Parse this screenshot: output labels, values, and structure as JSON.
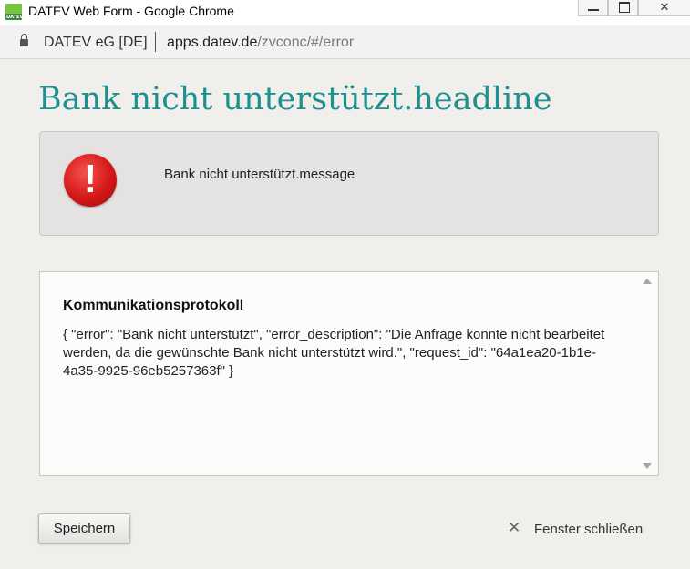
{
  "window": {
    "title": "DATEV Web Form - Google Chrome",
    "app_icon_text": "DATEV",
    "minimize_icon": "minimize-icon",
    "maximize_icon": "maximize-icon",
    "close_glyph": "✕"
  },
  "addressbar": {
    "site": "DATEV eG [DE]",
    "domain": "apps.datev.de",
    "path": "/zvconc/#/error",
    "lock_icon": "lock-icon"
  },
  "page": {
    "headline": "Bank nicht unterstützt.headline",
    "message": "Bank nicht unterstützt.message",
    "error_icon_glyph": "!",
    "log": {
      "title": "Kommunikationsprotokoll",
      "text": "{ \"error\": \"Bank nicht unterstützt\", \"error_description\": \"Die Anfrage konnte nicht bearbeitet werden, da die gewünschte Bank nicht unterstützt wird.\", \"request_id\": \"64a1ea20-1b1e-4a35-9925-96eb5257363f\" }"
    },
    "save_button": "Speichern",
    "close_link": "Fenster schließen",
    "close_link_glyph": "✕"
  },
  "colors": {
    "headline": "#1e918f",
    "error_icon": "#d41818"
  }
}
